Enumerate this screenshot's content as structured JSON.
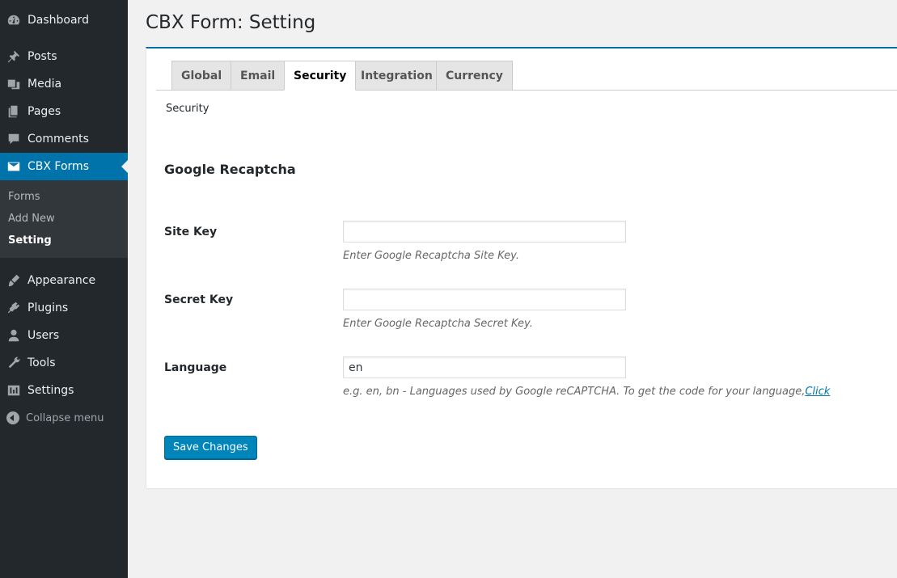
{
  "sidebar": {
    "items": [
      {
        "label": "Dashboard",
        "icon": "dashboard-icon"
      },
      {
        "label": "Posts",
        "icon": "pin-icon"
      },
      {
        "label": "Media",
        "icon": "media-icon"
      },
      {
        "label": "Pages",
        "icon": "pages-icon"
      },
      {
        "label": "Comments",
        "icon": "comment-icon"
      },
      {
        "label": "CBX Forms",
        "icon": "envelope-icon",
        "current": true
      },
      {
        "label": "Appearance",
        "icon": "paintbrush-icon"
      },
      {
        "label": "Plugins",
        "icon": "plugin-icon"
      },
      {
        "label": "Users",
        "icon": "user-icon"
      },
      {
        "label": "Tools",
        "icon": "wrench-icon"
      },
      {
        "label": "Settings",
        "icon": "settings-icon"
      }
    ],
    "submenu": [
      "Forms",
      "Add New",
      "Setting"
    ],
    "collapse_label": "Collapse menu"
  },
  "page": {
    "title": "CBX Form: Setting"
  },
  "tabs": [
    "Global",
    "Email",
    "Security",
    "Integration",
    "Currency"
  ],
  "active_tab": "Security",
  "section": {
    "label": "Security",
    "heading": "Google Recaptcha"
  },
  "fields": {
    "site_key": {
      "label": "Site Key",
      "value": "",
      "description": "Enter Google Recaptcha Site Key."
    },
    "secret_key": {
      "label": "Secret Key",
      "value": "",
      "description": "Enter Google Recaptcha Secret Key."
    },
    "language": {
      "label": "Language",
      "value": "en",
      "description": "e.g. en, bn - Languages used by Google reCAPTCHA. To get the code for your language,",
      "link_text": "Click"
    }
  },
  "save_button": "Save Changes",
  "colors": {
    "sidebar_bg": "#23282d",
    "accent": "#0073aa",
    "button": "#0085ba"
  }
}
